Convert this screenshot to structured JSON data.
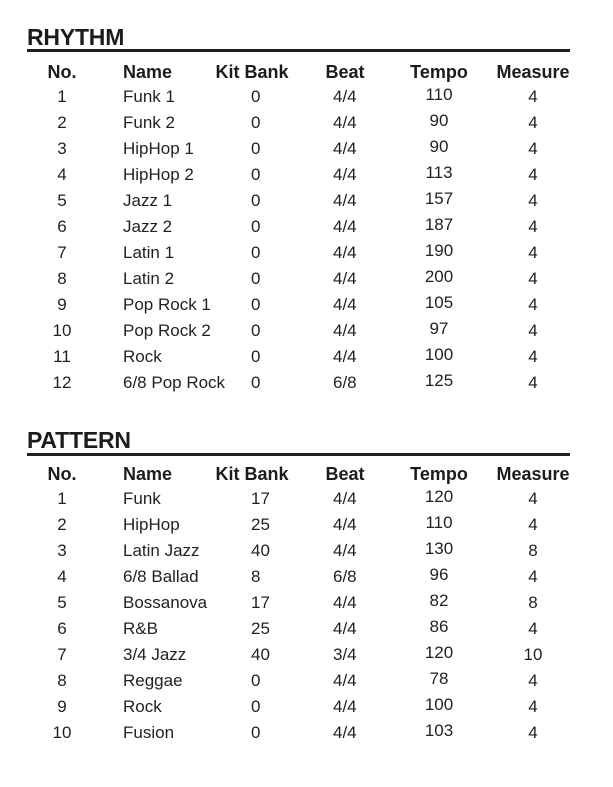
{
  "columns": {
    "no": "No.",
    "name": "Name",
    "kit_bank": "Kit Bank",
    "beat": "Beat",
    "tempo": "Tempo",
    "measure": "Measure"
  },
  "rhythm": {
    "title": "RHYTHM",
    "rows": [
      {
        "no": "1",
        "name": "Funk 1",
        "kit_bank": "0",
        "beat": "4/4",
        "tempo": "110",
        "measure": "4"
      },
      {
        "no": "2",
        "name": "Funk 2",
        "kit_bank": "0",
        "beat": "4/4",
        "tempo": "90",
        "measure": "4"
      },
      {
        "no": "3",
        "name": "HipHop 1",
        "kit_bank": "0",
        "beat": "4/4",
        "tempo": "90",
        "measure": "4"
      },
      {
        "no": "4",
        "name": "HipHop 2",
        "kit_bank": "0",
        "beat": "4/4",
        "tempo": "113",
        "measure": "4"
      },
      {
        "no": "5",
        "name": "Jazz 1",
        "kit_bank": "0",
        "beat": "4/4",
        "tempo": "157",
        "measure": "4"
      },
      {
        "no": "6",
        "name": "Jazz 2",
        "kit_bank": "0",
        "beat": "4/4",
        "tempo": "187",
        "measure": "4"
      },
      {
        "no": "7",
        "name": "Latin 1",
        "kit_bank": "0",
        "beat": "4/4",
        "tempo": "190",
        "measure": "4"
      },
      {
        "no": "8",
        "name": "Latin 2",
        "kit_bank": "0",
        "beat": "4/4",
        "tempo": "200",
        "measure": "4"
      },
      {
        "no": "9",
        "name": "Pop Rock 1",
        "kit_bank": "0",
        "beat": "4/4",
        "tempo": "105",
        "measure": "4"
      },
      {
        "no": "10",
        "name": "Pop Rock 2",
        "kit_bank": "0",
        "beat": "4/4",
        "tempo": "97",
        "measure": "4"
      },
      {
        "no": "11",
        "name": "Rock",
        "kit_bank": "0",
        "beat": "4/4",
        "tempo": "100",
        "measure": "4"
      },
      {
        "no": "12",
        "name": "6/8 Pop Rock",
        "kit_bank": "0",
        "beat": "6/8",
        "tempo": "125",
        "measure": "4"
      }
    ]
  },
  "pattern": {
    "title": "PATTERN",
    "rows": [
      {
        "no": "1",
        "name": "Funk",
        "kit_bank": "17",
        "beat": "4/4",
        "tempo": "120",
        "measure": "4"
      },
      {
        "no": "2",
        "name": "HipHop",
        "kit_bank": "25",
        "beat": "4/4",
        "tempo": "110",
        "measure": "4"
      },
      {
        "no": "3",
        "name": "Latin Jazz",
        "kit_bank": "40",
        "beat": "4/4",
        "tempo": "130",
        "measure": "8"
      },
      {
        "no": "4",
        "name": "6/8 Ballad",
        "kit_bank": "8",
        "beat": "6/8",
        "tempo": "96",
        "measure": "4"
      },
      {
        "no": "5",
        "name": "Bossanova",
        "kit_bank": "17",
        "beat": "4/4",
        "tempo": "82",
        "measure": "8"
      },
      {
        "no": "6",
        "name": "R&B",
        "kit_bank": "25",
        "beat": "4/4",
        "tempo": "86",
        "measure": "4"
      },
      {
        "no": "7",
        "name": "3/4 Jazz",
        "kit_bank": "40",
        "beat": "3/4",
        "tempo": "120",
        "measure": "10"
      },
      {
        "no": "8",
        "name": "Reggae",
        "kit_bank": "0",
        "beat": "4/4",
        "tempo": "78",
        "measure": "4"
      },
      {
        "no": "9",
        "name": "Rock",
        "kit_bank": "0",
        "beat": "4/4",
        "tempo": "100",
        "measure": "4"
      },
      {
        "no": "10",
        "name": "Fusion",
        "kit_bank": "0",
        "beat": "4/4",
        "tempo": "103",
        "measure": "4"
      }
    ]
  }
}
